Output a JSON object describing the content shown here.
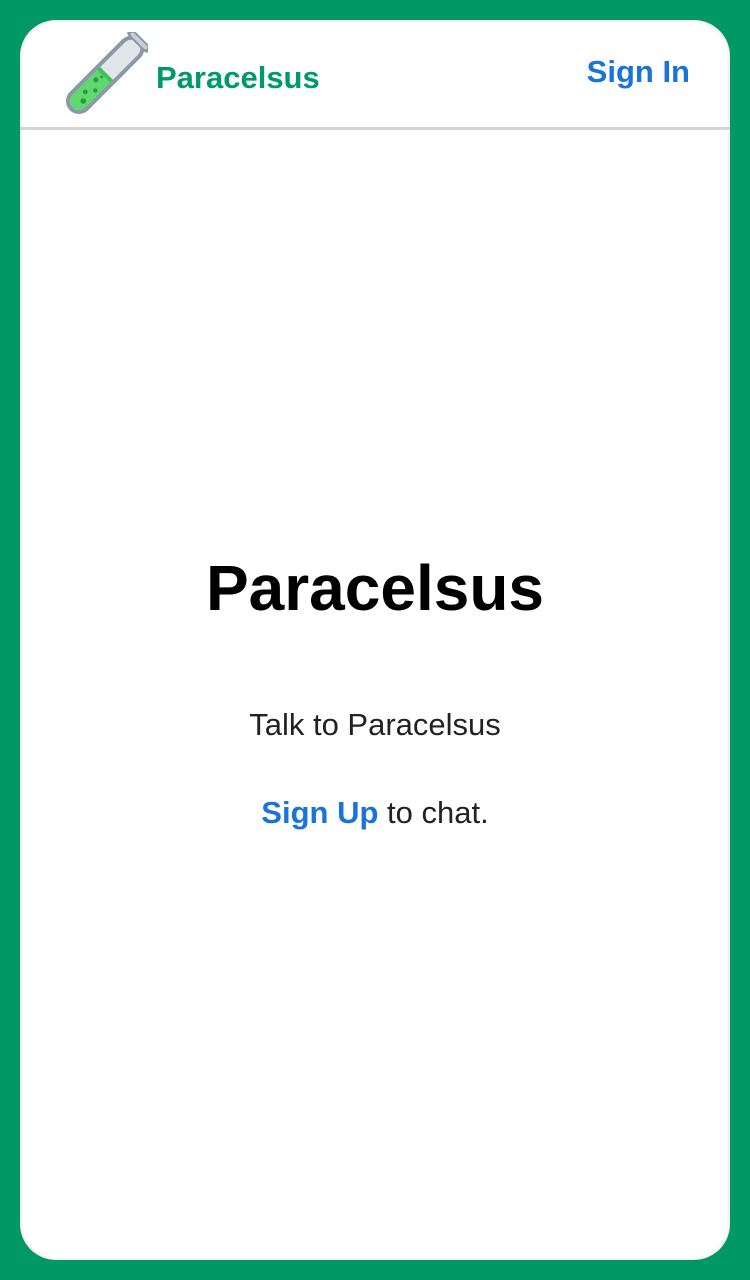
{
  "header": {
    "logo_icon": "test-tube-icon",
    "brand_name": "Paracelsus",
    "signin_label": "Sign In"
  },
  "hero": {
    "title": "Paracelsus",
    "subtitle": "Talk to Paracelsus",
    "signup_label": "Sign Up",
    "cta_suffix": " to chat."
  },
  "colors": {
    "background": "#009966",
    "brand": "#00996b",
    "link": "#1a73d9",
    "divider": "#d4d4d4"
  }
}
